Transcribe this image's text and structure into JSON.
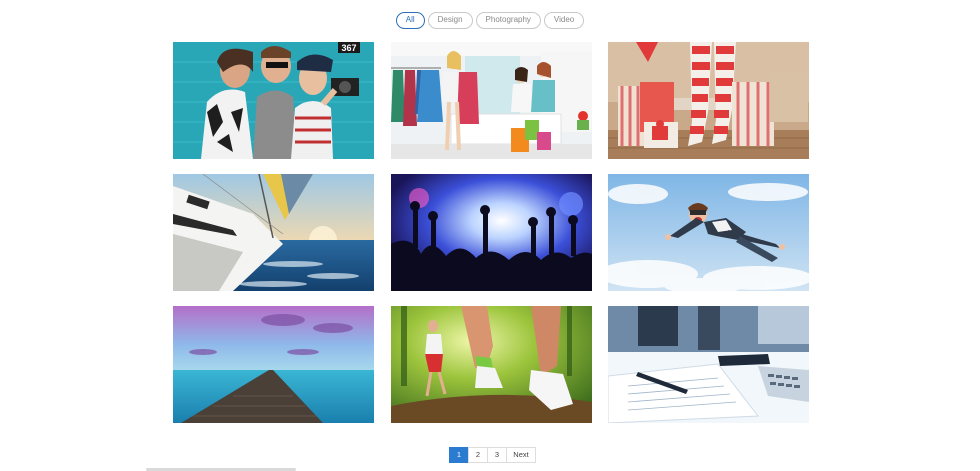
{
  "filters": {
    "items": [
      {
        "label": "All",
        "active": true
      },
      {
        "label": "Design",
        "active": false
      },
      {
        "label": "Photography",
        "active": false
      },
      {
        "label": "Video",
        "active": false
      }
    ]
  },
  "gallery": {
    "tiles": [
      {
        "subject": "friends-selfie",
        "sign_text": "367"
      },
      {
        "subject": "shopping-boutique"
      },
      {
        "subject": "christmas-gifts"
      },
      {
        "subject": "sailboat-sea"
      },
      {
        "subject": "concert-crowd"
      },
      {
        "subject": "skydiver"
      },
      {
        "subject": "pier-sunset"
      },
      {
        "subject": "running-forest"
      },
      {
        "subject": "desk-documents"
      }
    ]
  },
  "pagination": {
    "pages": [
      "1",
      "2",
      "3"
    ],
    "current": "1",
    "next_label": "Next"
  },
  "colors": {
    "accent": "#2b7bd1",
    "filter_active": "#2b6fb8",
    "border": "#dddddd"
  }
}
